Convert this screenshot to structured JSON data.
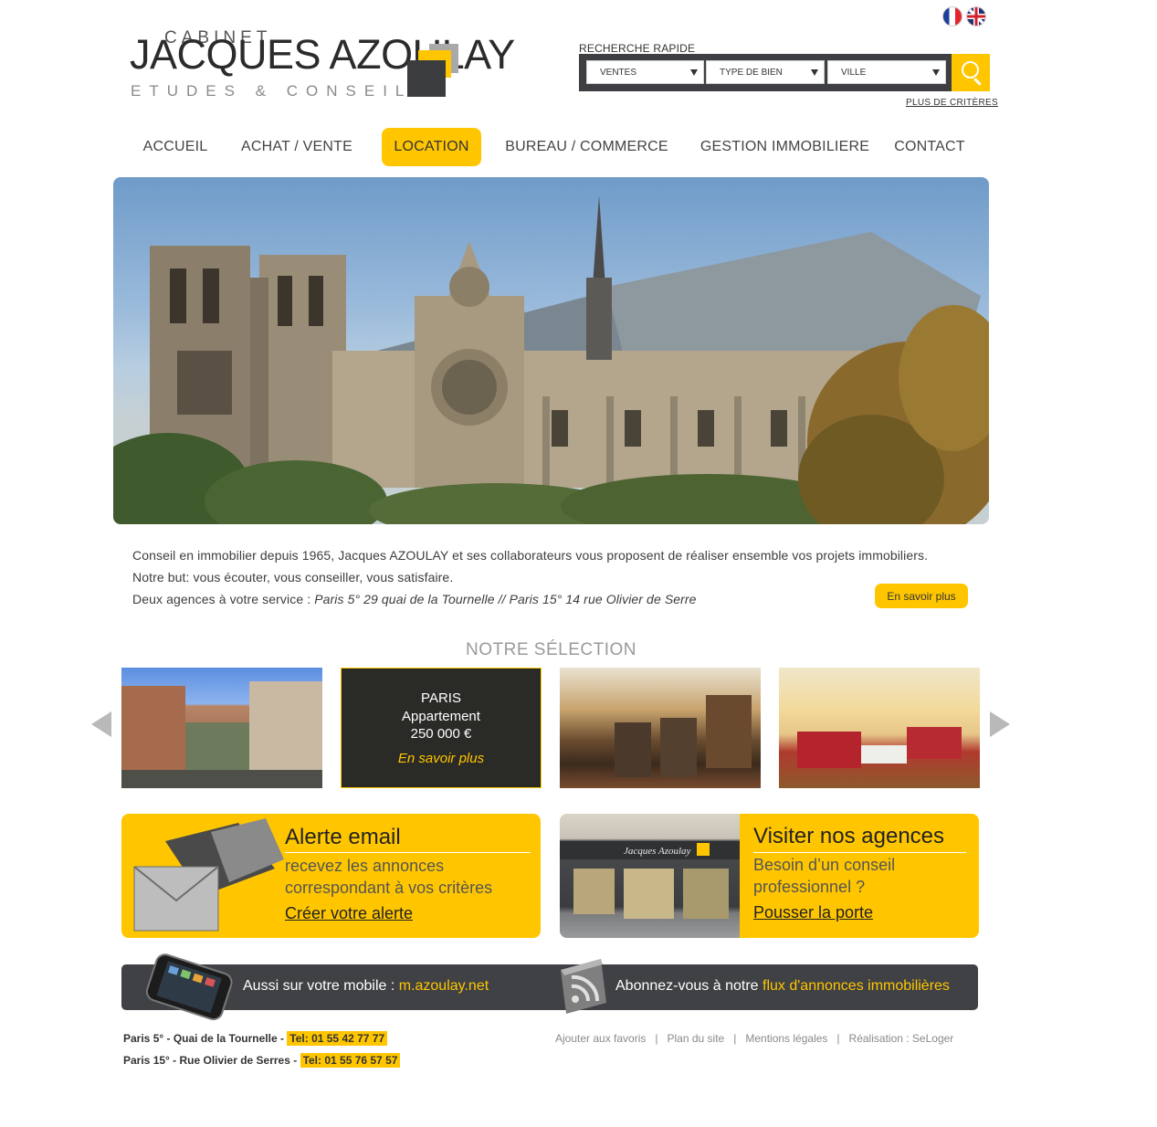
{
  "header": {
    "lang_fr_icon": "flag-fr-icon",
    "lang_en_icon": "flag-uk-icon",
    "logo": {
      "top": "CABINET",
      "name": "JACQUES AZOULAY",
      "sub": "ETUDES & CONSEILS"
    }
  },
  "search": {
    "title": "RECHERCHE RAPIDE",
    "transaction": "VENTES",
    "property_type": "TYPE DE BIEN",
    "city": "VILLE",
    "button_icon": "search-icon",
    "more_link": "PLUS DE CRITÈRES"
  },
  "nav": {
    "items": [
      {
        "label": "ACCUEIL"
      },
      {
        "label": "ACHAT / VENTE"
      },
      {
        "label": "LOCATION"
      },
      {
        "label": "BUREAU / COMMERCE"
      },
      {
        "label": "GESTION IMMOBILIERE"
      },
      {
        "label": "CONTACT"
      }
    ],
    "active": "LOCATION"
  },
  "intro": {
    "line1": "Conseil en immobilier depuis 1965, Jacques AZOULAY et ses collaborateurs vous proposent de réaliser ensemble vos projets immobiliers.",
    "line2": "Notre but: vous écouter, vous conseiller, vous satisfaire.",
    "line3_prefix": "Deux agences à votre service : ",
    "line3_agencies": "Paris 5° 29 quai de la Tournelle // Paris 15° 14 rue Olivier de Serre",
    "more_button": "En savoir plus"
  },
  "selection": {
    "title": "NOTRE SÉLECTION",
    "featured": {
      "city": "PARIS",
      "type": "Appartement",
      "price": "250 000 €",
      "link": "En savoir plus"
    }
  },
  "promos": {
    "alert": {
      "title": "Alerte email",
      "text1": "recevez les annonces",
      "text2": "correspondant à vos critères",
      "cta": "Créer votre alerte"
    },
    "agencies": {
      "title": "Visiter nos agences",
      "text1": "Besoin d’un conseil",
      "text2": "professionnel ?",
      "cta": "Pousser la porte",
      "sign_text": "Jacques Azoulay"
    }
  },
  "bar": {
    "mobile_prefix": "Aussi sur votre mobile : ",
    "mobile_link": "m.azoulay.net",
    "rss_prefix": "Abonnez-vous à notre ",
    "rss_link": "flux d'annonces immobilières"
  },
  "footer": {
    "agency1": "Paris 5° - Quai de la Tournelle - ",
    "tel1": "Tel: 01 55 42 77 77",
    "agency2": "Paris 15° - Rue Olivier de Serres - ",
    "tel2": "Tel: 01 55 76 57 57",
    "links": [
      "Ajouter aux favoris",
      "Plan du site",
      "Mentions légales",
      "Réalisation : SeLoger"
    ],
    "sep": "|"
  },
  "colors": {
    "accent": "#ffc600",
    "dark": "#3f4144"
  }
}
